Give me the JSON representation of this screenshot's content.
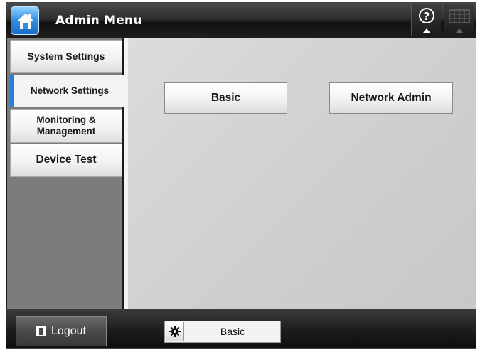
{
  "header": {
    "title": "Admin Menu",
    "home_icon": "home-icon",
    "help_icon": "help-icon",
    "keyboard_icon": "keyboard-icon"
  },
  "sidebar": {
    "items": [
      {
        "label": "System Settings",
        "selected": false
      },
      {
        "label": "Network Settings",
        "selected": true
      },
      {
        "label": "Monitoring & Management",
        "selected": false
      },
      {
        "label": "Device Test",
        "selected": false
      }
    ],
    "accent_color": "#2a7fd8"
  },
  "main": {
    "buttons": [
      {
        "label": "Basic"
      },
      {
        "label": "Network Admin"
      }
    ]
  },
  "footer": {
    "logout_label": "Logout",
    "mode_label": "Basic",
    "mode_icon": "gear-icon"
  }
}
